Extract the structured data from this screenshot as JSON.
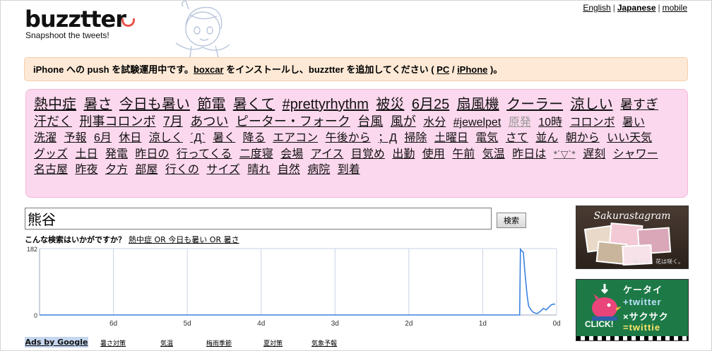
{
  "header": {
    "logo": "buzztter",
    "tagline": "Snapshoot the tweets!",
    "lang": {
      "english": "English",
      "japanese": "Japanese",
      "mobile": "mobile"
    }
  },
  "notice": {
    "text1": "iPhone への push を試験運用中です。",
    "boxcar": "boxcar",
    "text2": " をインストールし、buzztter を追加してください ( ",
    "pc": "PC",
    "slash": " / ",
    "iphone": "iPhone",
    "text3": " )。"
  },
  "trends": [
    {
      "t": "熱中症",
      "s": 20
    },
    {
      "t": "暑さ",
      "s": 20
    },
    {
      "t": "今日も暑い",
      "s": 20
    },
    {
      "t": "節電",
      "s": 20
    },
    {
      "t": "暑くて",
      "s": 20
    },
    {
      "t": "#prettyrhythm",
      "s": 20
    },
    {
      "t": "被災",
      "s": 20
    },
    {
      "t": "6月25",
      "s": 20
    },
    {
      "t": "扇風機",
      "s": 20
    },
    {
      "t": "クーラー",
      "s": 20
    },
    {
      "t": "涼しい",
      "s": 20
    },
    {
      "t": "暑すぎ",
      "s": 18
    },
    {
      "t": "汗だく",
      "s": 18
    },
    {
      "t": "刑事コロンボ",
      "s": 18
    },
    {
      "t": "7月",
      "s": 18
    },
    {
      "t": "あつい",
      "s": 18
    },
    {
      "t": "ピーター・フォーク",
      "s": 18
    },
    {
      "t": "台風",
      "s": 18
    },
    {
      "t": "風が",
      "s": 18
    },
    {
      "t": "水分",
      "s": 16
    },
    {
      "t": "#jewelpet",
      "s": 16
    },
    {
      "t": "原発",
      "s": 16,
      "c": "#999"
    },
    {
      "t": "10時",
      "s": 16
    },
    {
      "t": "コロンボ",
      "s": 16
    },
    {
      "t": "暑い",
      "s": 16
    },
    {
      "t": "洗濯",
      "s": 16
    },
    {
      "t": "予報",
      "s": 16
    },
    {
      "t": "6月",
      "s": 16
    },
    {
      "t": "休日",
      "s": 16
    },
    {
      "t": "涼しく",
      "s": 16
    },
    {
      "t": "´Д`",
      "s": 16
    },
    {
      "t": "暑く",
      "s": 16
    },
    {
      "t": "降る",
      "s": 16
    },
    {
      "t": "エアコン",
      "s": 16
    },
    {
      "t": "午後から",
      "s": 16
    },
    {
      "t": "；Д",
      "s": 16
    },
    {
      "t": "掃除",
      "s": 16
    },
    {
      "t": "土曜日",
      "s": 16
    },
    {
      "t": "電気",
      "s": 16
    },
    {
      "t": "さて",
      "s": 16
    },
    {
      "t": "並ん",
      "s": 16
    },
    {
      "t": "朝から",
      "s": 16
    },
    {
      "t": "いい天気",
      "s": 16
    },
    {
      "t": "グッズ",
      "s": 16
    },
    {
      "t": "土日",
      "s": 16
    },
    {
      "t": "発電",
      "s": 16
    },
    {
      "t": "昨日の",
      "s": 16
    },
    {
      "t": "行ってくる",
      "s": 16
    },
    {
      "t": "二度寝",
      "s": 16
    },
    {
      "t": "会場",
      "s": 16
    },
    {
      "t": "アイス",
      "s": 16
    },
    {
      "t": "目覚め",
      "s": 16
    },
    {
      "t": "出勤",
      "s": 16
    },
    {
      "t": "使用",
      "s": 16
    },
    {
      "t": "午前",
      "s": 16
    },
    {
      "t": "気温",
      "s": 16
    },
    {
      "t": "昨日は",
      "s": 16
    },
    {
      "t": "*´▽`*",
      "s": 14,
      "c": "#555"
    },
    {
      "t": "遅刻",
      "s": 16
    },
    {
      "t": "シャワー",
      "s": 16
    },
    {
      "t": "名古屋",
      "s": 16
    },
    {
      "t": "昨夜",
      "s": 16
    },
    {
      "t": "夕方",
      "s": 16
    },
    {
      "t": "部屋",
      "s": 16
    },
    {
      "t": "行くの",
      "s": 16
    },
    {
      "t": "サイズ",
      "s": 16
    },
    {
      "t": "晴れ",
      "s": 16
    },
    {
      "t": "自然",
      "s": 16
    },
    {
      "t": "病院",
      "s": 16
    },
    {
      "t": "到着",
      "s": 16
    }
  ],
  "search": {
    "value": "熊谷",
    "button": "検索"
  },
  "suggest": {
    "label": "こんな検索はいかがですか？",
    "query": "熱中症 OR 今日も暑い OR 暑さ"
  },
  "chart_data": {
    "type": "line",
    "ylim": [
      0,
      182
    ],
    "y_ticks": [
      "182",
      "0"
    ],
    "x_ticks": [
      "6d",
      "5d",
      "4d",
      "3d",
      "2d",
      "1d",
      "0d"
    ],
    "x_unit": "days ago",
    "x": [
      7.0,
      0.5,
      0.49,
      0.47,
      0.45,
      0.43,
      0.4,
      0.38,
      0.35,
      0.32,
      0.29,
      0.26,
      0.22,
      0.18,
      0.14,
      0.1,
      0.07,
      0.04,
      0.02
    ],
    "y": [
      0,
      0,
      180,
      175,
      172,
      120,
      55,
      25,
      15,
      8,
      5,
      4,
      10,
      18,
      14,
      22,
      28,
      30,
      29
    ],
    "line_color": "#3b82e0",
    "grid_color": "#c9d3e6"
  },
  "ads": {
    "label": "Ads by Google",
    "links": [
      "暑さ対策",
      "気温",
      "梅雨季節",
      "夏対策",
      "気象予報"
    ]
  },
  "banners": {
    "sakura": {
      "title": "Sakurastagram",
      "sub": "もっと、花は咲く。"
    },
    "twittie": {
      "row1": "ケータイ",
      "row2": "+twitter",
      "row3": "×サクサク",
      "row4": "=twittie",
      "click": "CLICK!"
    }
  }
}
